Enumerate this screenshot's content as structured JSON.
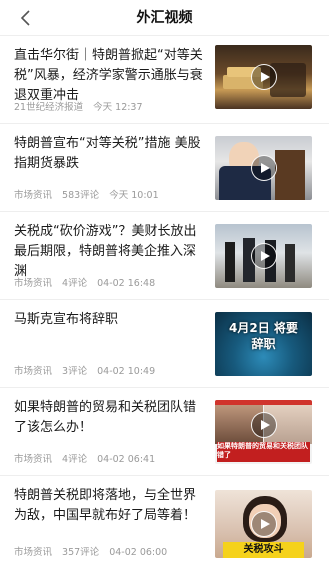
{
  "header": {
    "title": "外汇视频",
    "back_icon": "chevron-left-icon"
  },
  "news": [
    {
      "title": "直击华尔街｜特朗普掀起“对等关税”风暴，经济学家警示通胀与衰退双重冲击",
      "source": "21世纪经济报道",
      "comments": "",
      "time": "今天 12:37",
      "thumbnail_text": ""
    },
    {
      "title": "特朗普宣布“对等关税”措施 美股指期货暴跌",
      "source": "市场资讯",
      "comments": "583评论",
      "time": "今天 10:01",
      "thumbnail_text": ""
    },
    {
      "title": "关税成“砍价游戏”？美财长放出最后期限，特朗普将美企推入深渊",
      "source": "市场资讯",
      "comments": "4评论",
      "time": "04-02 16:48",
      "thumbnail_text": ""
    },
    {
      "title": "马斯克宣布将辞职",
      "source": "市场资讯",
      "comments": "3评论",
      "time": "04-02 10:49",
      "thumbnail_text": "4月2日 将要辞职"
    },
    {
      "title": "如果特朗普的贸易和关税团队错了该怎么办！",
      "source": "市场资讯",
      "comments": "4评论",
      "time": "04-02 06:41",
      "thumbnail_text": "如果特朗普的贸易和关税团队错了"
    },
    {
      "title": "特朗普关税即将落地，与全世界为敌，中国早就布好了局等着！",
      "source": "市场资讯",
      "comments": "357评论",
      "time": "04-02 06:00",
      "thumbnail_text": "关税攻斗"
    }
  ],
  "colors": {
    "meta_text": "#9a9a9a",
    "divider": "#eeeeee",
    "headline": "#1a1a1a"
  },
  "icons": {
    "play": "play-icon"
  }
}
